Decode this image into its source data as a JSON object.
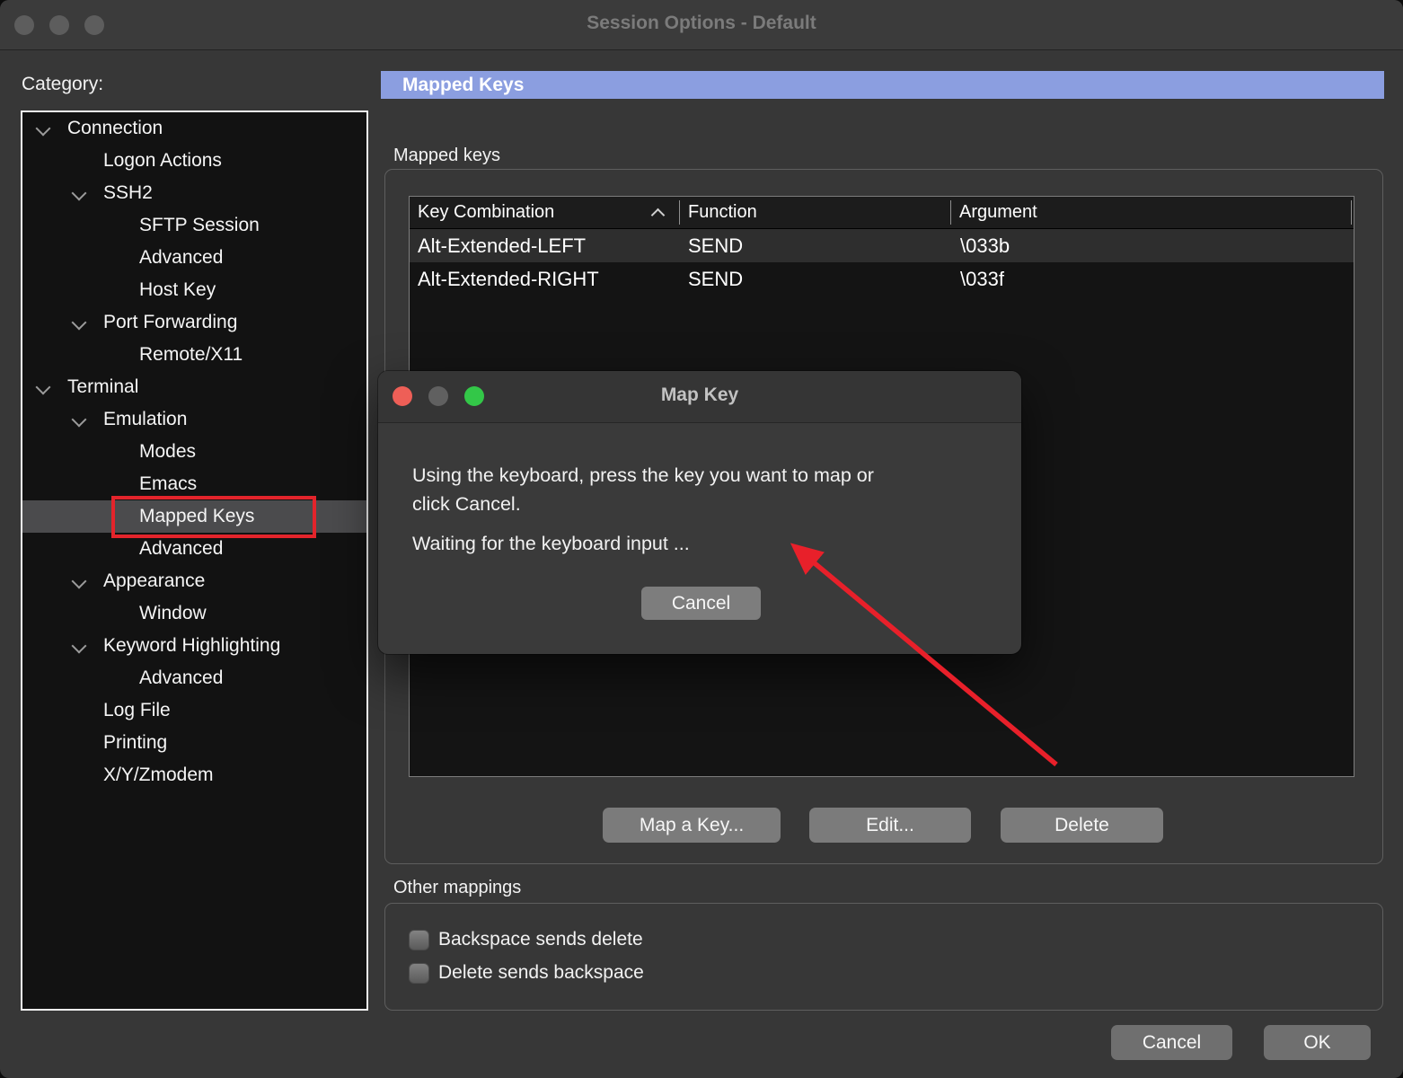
{
  "window": {
    "title": "Session Options - Default"
  },
  "sidebar": {
    "label": "Category:",
    "items": [
      {
        "label": "Connection",
        "level": 0,
        "chevron": true
      },
      {
        "label": "Logon Actions",
        "level": 1,
        "chevron": false
      },
      {
        "label": "SSH2",
        "level": 1,
        "chevron": true
      },
      {
        "label": "SFTP Session",
        "level": 2,
        "chevron": false
      },
      {
        "label": "Advanced",
        "level": 2,
        "chevron": false
      },
      {
        "label": "Host Key",
        "level": 2,
        "chevron": false
      },
      {
        "label": "Port Forwarding",
        "level": 1,
        "chevron": true
      },
      {
        "label": "Remote/X11",
        "level": 2,
        "chevron": false
      },
      {
        "label": "Terminal",
        "level": 0,
        "chevron": true
      },
      {
        "label": "Emulation",
        "level": 1,
        "chevron": true
      },
      {
        "label": "Modes",
        "level": 2,
        "chevron": false
      },
      {
        "label": "Emacs",
        "level": 2,
        "chevron": false
      },
      {
        "label": "Mapped Keys",
        "level": 2,
        "chevron": false,
        "selected": true,
        "annotated": true
      },
      {
        "label": "Advanced",
        "level": 2,
        "chevron": false
      },
      {
        "label": "Appearance",
        "level": 1,
        "chevron": true
      },
      {
        "label": "Window",
        "level": 2,
        "chevron": false
      },
      {
        "label": "Keyword Highlighting",
        "level": 1,
        "chevron": true
      },
      {
        "label": "Advanced",
        "level": 2,
        "chevron": false
      },
      {
        "label": "Log File",
        "level": 1,
        "chevron": false
      },
      {
        "label": "Printing",
        "level": 1,
        "chevron": false
      },
      {
        "label": "X/Y/Zmodem",
        "level": 1,
        "chevron": false
      }
    ]
  },
  "main": {
    "header": "Mapped Keys",
    "mapped_keys_group": {
      "label": "Mapped keys",
      "table": {
        "columns": [
          "Key Combination",
          "Function",
          "Argument"
        ],
        "sort_column": "Key Combination",
        "sort_direction": "ascending",
        "rows": [
          [
            "Alt-Extended-LEFT",
            "SEND",
            "\\033b"
          ],
          [
            "Alt-Extended-RIGHT",
            "SEND",
            "\\033f"
          ]
        ]
      },
      "buttons": {
        "map_a_key": "Map a Key...",
        "edit": "Edit...",
        "delete": "Delete"
      }
    },
    "other_mappings_group": {
      "label": "Other mappings",
      "checkboxes": [
        {
          "label": "Backspace sends delete",
          "checked": false
        },
        {
          "label": "Delete sends backspace",
          "checked": false
        }
      ]
    },
    "footer": {
      "cancel": "Cancel",
      "ok": "OK"
    }
  },
  "dialog": {
    "title": "Map Key",
    "message_line1": "Using the keyboard, press the key you want to map or",
    "message_line2": "click Cancel.",
    "status": "Waiting for the keyboard input ...",
    "cancel_label": "Cancel"
  },
  "colors": {
    "accent_header_blue": "#8b9ee0",
    "annotation_red": "#e3242b",
    "selection_gray": "#4b4b4d",
    "window_bg": "#373737",
    "tree_bg": "#121212",
    "table_alt_row": "#2e2e2e"
  }
}
